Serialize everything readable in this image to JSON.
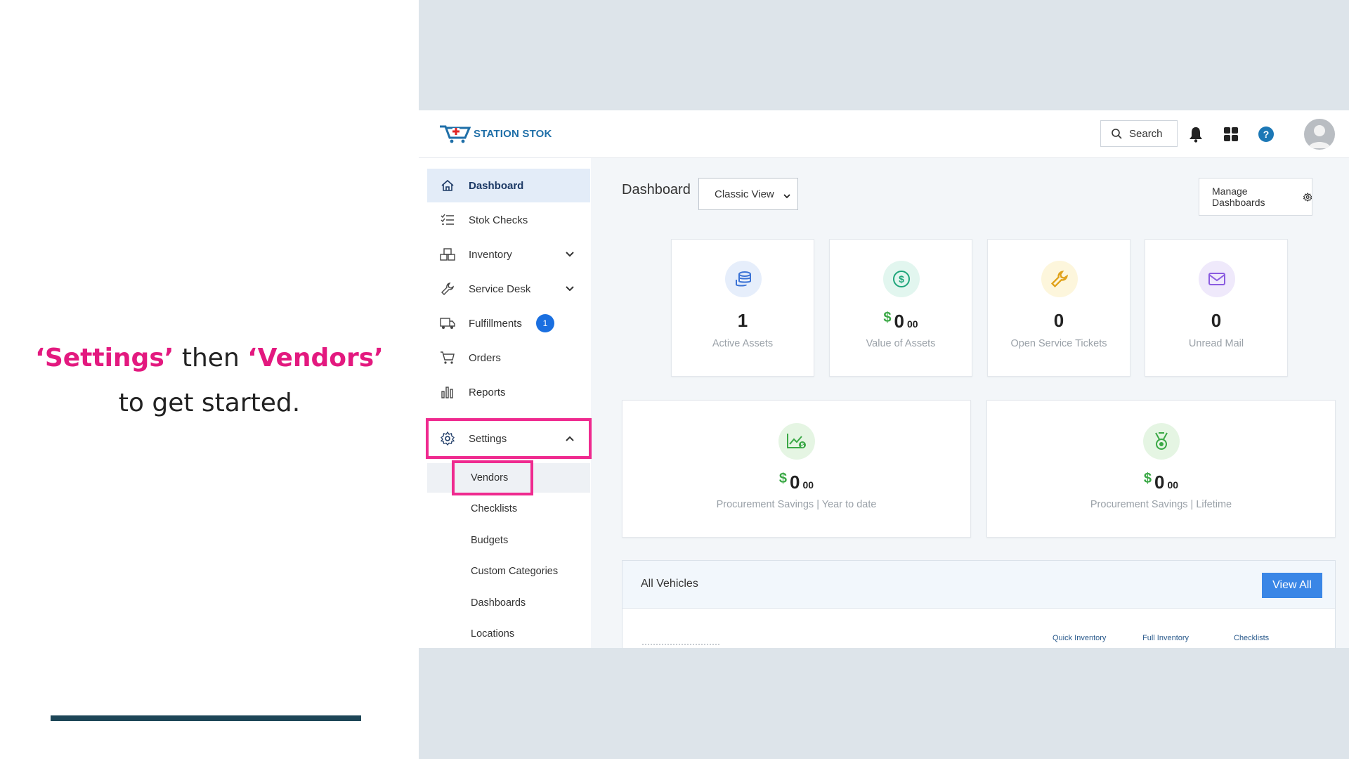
{
  "instruction": {
    "part1": "‘Settings’",
    "part2": " then ",
    "part3": "‘Vendors’",
    "line2": "to get started."
  },
  "app": {
    "logo_text": "STATION STOK",
    "search_label": "Search"
  },
  "sidebar": {
    "items": [
      {
        "label": "Dashboard",
        "icon": "home-icon"
      },
      {
        "label": "Stok Checks",
        "icon": "checklist-icon"
      },
      {
        "label": "Inventory",
        "icon": "boxes-icon"
      },
      {
        "label": "Service Desk",
        "icon": "wrench-icon"
      },
      {
        "label": "Fulfillments",
        "icon": "truck-icon",
        "badge": "1"
      },
      {
        "label": "Orders",
        "icon": "cart-icon"
      },
      {
        "label": "Reports",
        "icon": "bar-chart-icon"
      },
      {
        "label": "Settings",
        "icon": "gear-icon"
      }
    ],
    "settings_sub": [
      "Vendors",
      "Checklists",
      "Budgets",
      "Custom Categories",
      "Dashboards",
      "Locations"
    ]
  },
  "main": {
    "title": "Dashboard",
    "view_select": "Classic View",
    "manage_label": "Manage Dashboards",
    "cards": [
      {
        "value": "1",
        "label": "Active Assets"
      },
      {
        "dollar": "$",
        "value": "0",
        "cents": "00",
        "label": "Value of Assets"
      },
      {
        "value": "0",
        "label": "Open Service Tickets"
      },
      {
        "value": "0",
        "label": "Unread Mail"
      }
    ],
    "wide_cards": [
      {
        "dollar": "$",
        "value": "0",
        "cents": "00",
        "label": "Procurement Savings | Year to date"
      },
      {
        "dollar": "$",
        "value": "0",
        "cents": "00",
        "label": "Procurement Savings | Lifetime"
      }
    ],
    "vehicles": {
      "title": "All Vehicles",
      "view_all": "View All",
      "columns": [
        "Quick Inventory",
        "Full Inventory",
        "Checklists"
      ]
    }
  },
  "colors": {
    "highlight": "#ef2a8f",
    "accent_blue": "#1a6fe0",
    "money_green": "#3aa845",
    "instruction_pink": "#e3197f"
  }
}
